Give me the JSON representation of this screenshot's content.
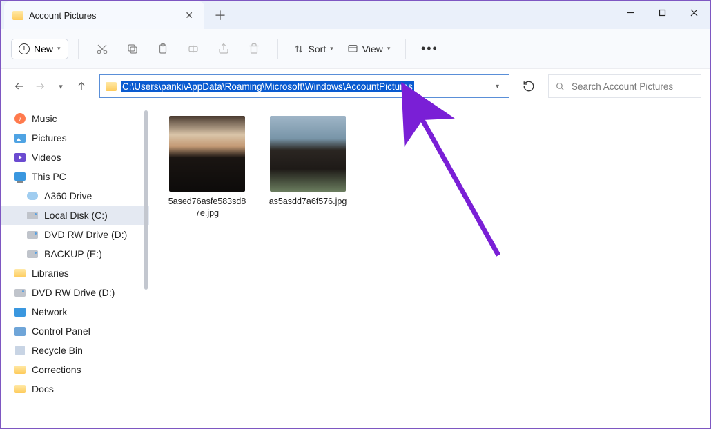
{
  "window_title": "Account Pictures",
  "toolbar": {
    "new_label": "New",
    "sort_label": "Sort",
    "view_label": "View"
  },
  "address_path": "C:\\Users\\panki\\AppData\\Roaming\\Microsoft\\Windows\\AccountPictures",
  "search_placeholder": "Search Account Pictures",
  "sidebar": {
    "items": [
      {
        "label": "Music",
        "icon": "music"
      },
      {
        "label": "Pictures",
        "icon": "pictures"
      },
      {
        "label": "Videos",
        "icon": "videos"
      },
      {
        "label": "This PC",
        "icon": "pc"
      },
      {
        "label": "A360 Drive",
        "icon": "cloud",
        "sub": true
      },
      {
        "label": "Local Disk (C:)",
        "icon": "drive",
        "sub": true,
        "selected": true
      },
      {
        "label": "DVD RW Drive (D:)",
        "icon": "drive",
        "sub": true
      },
      {
        "label": "BACKUP (E:)",
        "icon": "drive",
        "sub": true
      },
      {
        "label": "Libraries",
        "icon": "folder"
      },
      {
        "label": "DVD RW Drive (D:)",
        "icon": "drive"
      },
      {
        "label": "Network",
        "icon": "network"
      },
      {
        "label": "Control Panel",
        "icon": "cpl"
      },
      {
        "label": "Recycle Bin",
        "icon": "bin"
      },
      {
        "label": "Corrections",
        "icon": "folder"
      },
      {
        "label": "Docs",
        "icon": "folder"
      }
    ]
  },
  "files": [
    {
      "name": "5ased76asfe583sd87e.jpg"
    },
    {
      "name": "as5asdd7a6f576.jpg"
    }
  ]
}
